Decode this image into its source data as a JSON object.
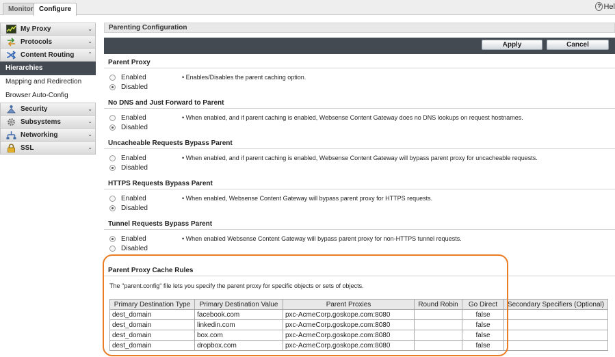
{
  "tabs": {
    "monitor": "Monitor",
    "configure": "Configure"
  },
  "help": {
    "label": "Hel"
  },
  "sidebar": {
    "groups_top": [
      {
        "label": "My Proxy",
        "icon": "gauge-icon"
      },
      {
        "label": "Protocols",
        "icon": "arrows-icon"
      },
      {
        "label": "Content Routing",
        "icon": "route-icon"
      }
    ],
    "active_item": "Hierarchies",
    "sub_items": [
      "Mapping and Redirection",
      "Browser Auto-Config"
    ],
    "groups_bottom": [
      {
        "label": "Security",
        "icon": "security-icon"
      },
      {
        "label": "Subsystems",
        "icon": "gear-icon"
      },
      {
        "label": "Networking",
        "icon": "network-icon"
      },
      {
        "label": "SSL",
        "icon": "lock-icon"
      }
    ]
  },
  "page": {
    "title": "Parenting Configuration",
    "apply": "Apply",
    "cancel": "Cancel"
  },
  "options": {
    "enabled": "Enabled",
    "disabled": "Disabled",
    "sections": [
      {
        "title": "Parent Proxy",
        "selected": "disabled",
        "desc": "• Enables/Disables the parent caching option."
      },
      {
        "title": "No DNS and Just Forward to Parent",
        "selected": "disabled",
        "desc": "• When enabled, and if parent caching is enabled, Websense Content Gateway does no DNS lookups on request hostnames."
      },
      {
        "title": "Uncacheable Requests Bypass Parent",
        "selected": "disabled",
        "desc": "• When enabled, and if parent caching is enabled, Websense Content Gateway will bypass parent proxy for uncacheable requests."
      },
      {
        "title": "HTTPS Requests Bypass Parent",
        "selected": "disabled",
        "desc": "• When enabled, Websense Content Gateway will bypass parent proxy for HTTPS requests."
      },
      {
        "title": "Tunnel Requests Bypass Parent",
        "selected": "enabled",
        "desc": "• When enabled Websense Content Gateway will bypass parent proxy for non-HTTPS tunnel requests."
      }
    ]
  },
  "cache_rules": {
    "title": "Parent Proxy Cache Rules",
    "intro": "The \"parent.config\" file lets you specify the parent proxy for specific objects or sets of objects.",
    "columns": [
      "Primary Destination Type",
      "Primary Destination Value",
      "Parent Proxies",
      "Round Robin",
      "Go Direct",
      "Secondary Specifiers (Optional)"
    ],
    "rows": [
      [
        "dest_domain",
        "facebook.com",
        "pxc-AcmeCorp.goskope.com:8080",
        "",
        "false",
        ""
      ],
      [
        "dest_domain",
        "linkedin.com",
        "pxc-AcmeCorp.goskope.com:8080",
        "",
        "false",
        ""
      ],
      [
        "dest_domain",
        "box.com",
        "pxc-AcmeCorp.goskope.com:8080",
        "",
        "false",
        ""
      ],
      [
        "dest_domain",
        "dropbox.com",
        "pxc-AcmeCorp.goskope.com:8080",
        "",
        "false",
        ""
      ]
    ]
  },
  "colors": {
    "toolbar": "#444a52",
    "highlight": "#ea7c23",
    "active_nav": "#444a52"
  }
}
